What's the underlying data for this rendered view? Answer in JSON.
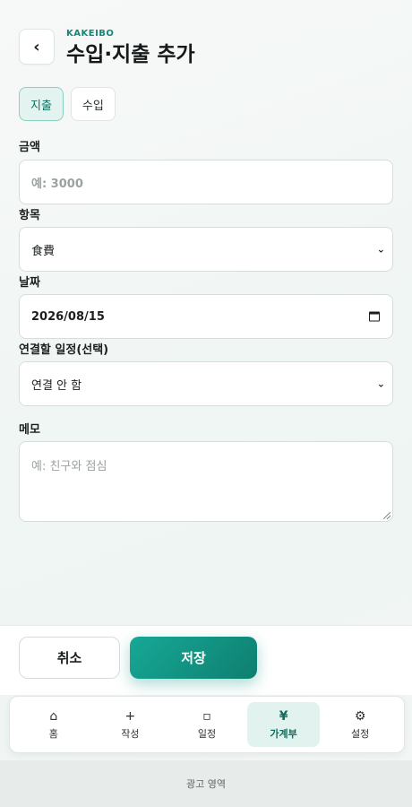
{
  "header": {
    "back_label": "‹",
    "brand": "KAKEIBO",
    "title": "수입·지출 추가"
  },
  "tabs": [
    {
      "label": "지출",
      "active": true
    },
    {
      "label": "수입",
      "active": false
    }
  ],
  "form": {
    "amount": {
      "label": "금액",
      "placeholder": "예: 3000",
      "value": ""
    },
    "category": {
      "label": "항목",
      "selected": "食費"
    },
    "date": {
      "label": "날짜",
      "value": "2026/08/15"
    },
    "schedule": {
      "label": "연결할 일정(선택)",
      "selected": "연결 안 함"
    },
    "memo": {
      "label": "메모",
      "placeholder": "예: 친구와 점심",
      "value": ""
    }
  },
  "actions": {
    "cancel_label": "취소",
    "save_label": "저장"
  },
  "nav": {
    "items": [
      {
        "icon": "home-icon",
        "glyph": "⌂",
        "label": "홈",
        "active": false
      },
      {
        "icon": "plus-icon",
        "glyph": "+",
        "label": "작성",
        "active": false
      },
      {
        "icon": "calendar-icon",
        "glyph": "▫",
        "label": "일정",
        "active": false
      },
      {
        "icon": "yen-icon",
        "glyph": "¥",
        "label": "가계부",
        "active": true
      },
      {
        "icon": "gear-icon",
        "glyph": "⚙",
        "label": "설정",
        "active": false
      }
    ]
  },
  "ad": {
    "label": "광고 영역"
  },
  "colors": {
    "accent": "#138774",
    "accent_bg": "#e2f3ef",
    "save_gradient_start": "#17a896",
    "save_gradient_end": "#0e7f70"
  }
}
